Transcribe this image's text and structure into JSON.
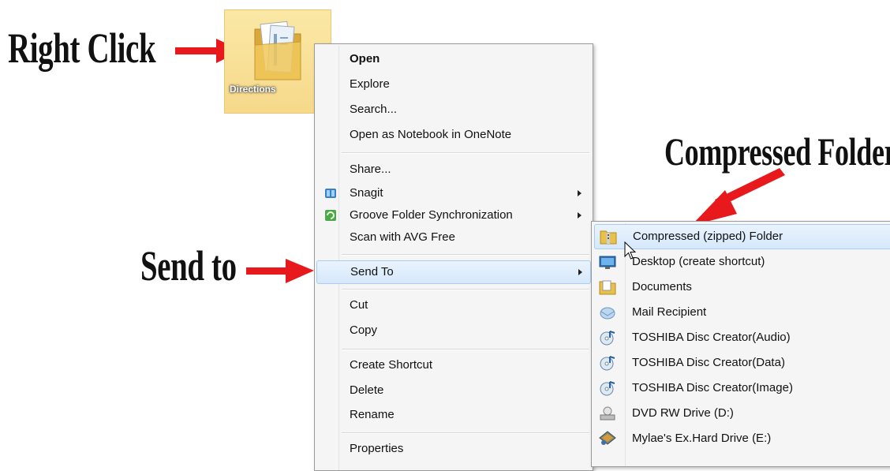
{
  "callouts": {
    "right_click": "Right Click",
    "send_to": "Send to",
    "compressed_folder": "Compressed Folder"
  },
  "desktop": {
    "folder_name": "Directions"
  },
  "context_menu": {
    "items": [
      {
        "label": "Open",
        "bold": true
      },
      {
        "label": "Explore"
      },
      {
        "label": "Search..."
      },
      {
        "label": "Open as Notebook in OneNote"
      },
      {
        "label": "Share..."
      },
      {
        "label": "Snagit",
        "icon": "snagit-icon",
        "submenu": true
      },
      {
        "label": "Groove Folder Synchronization",
        "icon": "groove-icon",
        "submenu": true
      },
      {
        "label": "Scan with AVG Free"
      },
      {
        "label": "Send To",
        "submenu": true,
        "highlighted": true
      },
      {
        "label": "Cut"
      },
      {
        "label": "Copy"
      },
      {
        "label": "Create Shortcut"
      },
      {
        "label": "Delete"
      },
      {
        "label": "Rename"
      },
      {
        "label": "Properties"
      }
    ]
  },
  "send_to_menu": {
    "items": [
      {
        "label": "Compressed (zipped) Folder",
        "icon": "zip-folder-icon",
        "highlighted": true
      },
      {
        "label": "Desktop (create shortcut)",
        "icon": "desktop-icon"
      },
      {
        "label": "Documents",
        "icon": "documents-folder-icon"
      },
      {
        "label": "Mail Recipient",
        "icon": "mail-icon"
      },
      {
        "label": "TOSHIBA Disc Creator(Audio)",
        "icon": "disc-icon"
      },
      {
        "label": "TOSHIBA Disc Creator(Data)",
        "icon": "disc-icon"
      },
      {
        "label": "TOSHIBA Disc Creator(Image)",
        "icon": "disc-icon"
      },
      {
        "label": "DVD RW Drive (D:)",
        "icon": "dvd-drive-icon"
      },
      {
        "label": "Mylae's Ex.Hard Drive (E:)",
        "icon": "hard-drive-icon"
      }
    ]
  },
  "colors": {
    "arrow": "#e8191c",
    "highlight": "#d6e8fb"
  }
}
